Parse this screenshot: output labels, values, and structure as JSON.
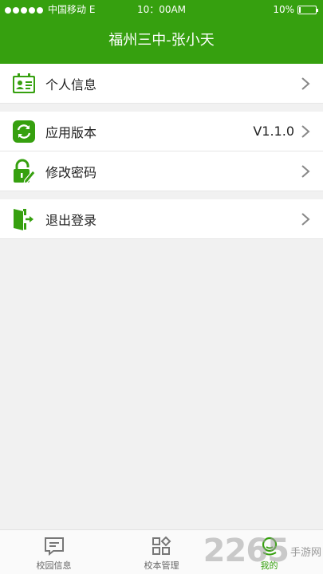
{
  "status": {
    "carrier": "中国移动 E",
    "time": "10：00AM",
    "battery_text": "10%",
    "battery_level": 0.1
  },
  "header": {
    "title": "福州三中-张小天"
  },
  "menu": {
    "profile": {
      "label": "个人信息",
      "icon": "id-card-icon"
    },
    "version": {
      "label": "应用版本",
      "value": "V1.1.0",
      "icon": "refresh-icon"
    },
    "password": {
      "label": "修改密码",
      "icon": "lock-edit-icon"
    },
    "logout": {
      "label": "退出登录",
      "icon": "exit-door-icon"
    }
  },
  "tabs": [
    {
      "label": "校园信息",
      "icon": "message-icon"
    },
    {
      "label": "校本管理",
      "icon": "grid-icon"
    },
    {
      "label": "我的",
      "icon": "user-icon",
      "active": true
    }
  ],
  "watermark": {
    "number": "2265",
    "text": "手游网"
  },
  "colors": {
    "brand": "#36a00f",
    "background": "#f1f1f1"
  }
}
